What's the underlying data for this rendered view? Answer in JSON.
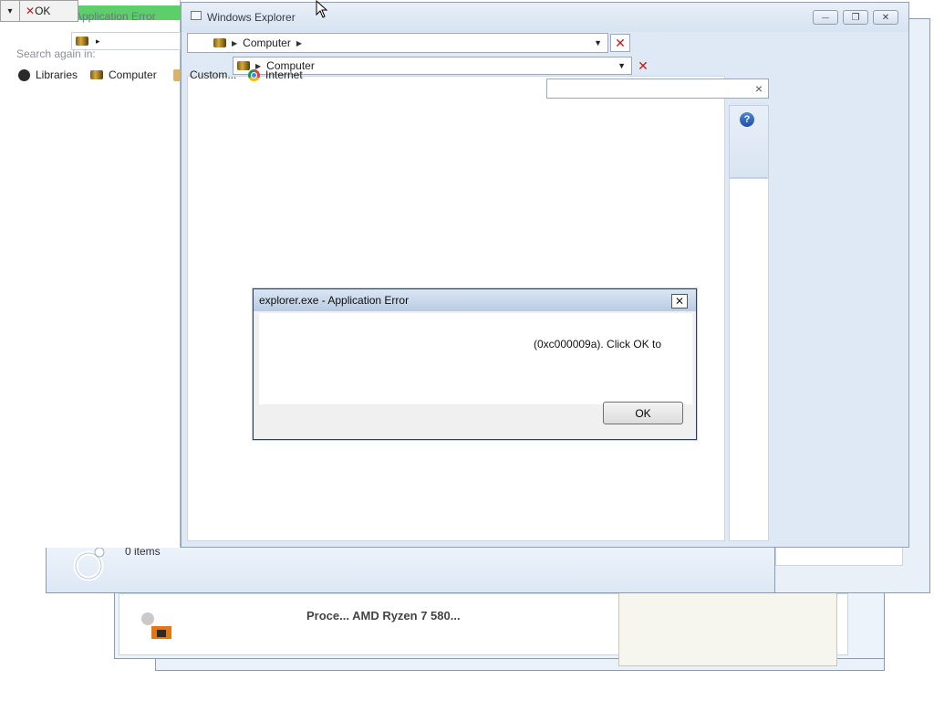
{
  "top_strip": {
    "ok_label": "OK",
    "dropdown_arrow": "▾"
  },
  "bg_window_left": {
    "title": "Application Error",
    "search_again_label": "Search again in:",
    "nav_items": [
      {
        "label": "Libraries",
        "icon": "libraries-icon"
      },
      {
        "label": "Computer",
        "icon": "computer-icon"
      },
      {
        "label": "Custom...",
        "icon": "folder-icon"
      },
      {
        "label": "Internet",
        "icon": "chrome-icon"
      }
    ],
    "address_arrow": "▸"
  },
  "explorer_window": {
    "title": "Windows Explorer",
    "caption_buttons": {
      "minimize": "—",
      "maximize": "❐",
      "close": "✕"
    },
    "address_path": "Computer",
    "address_path_2": "Computer",
    "search_clear": "×",
    "help_icon_label": "?"
  },
  "status_bar": {
    "items_count": "0 items"
  },
  "taskbar_ghost": {
    "processor_text": "Proce... AMD Ryzen 7 580..."
  },
  "error_dialog": {
    "title": "explorer.exe - Application Error",
    "message": "(0xc000009a). Click OK to",
    "ok_label": "OK",
    "close_symbol": "✕"
  }
}
